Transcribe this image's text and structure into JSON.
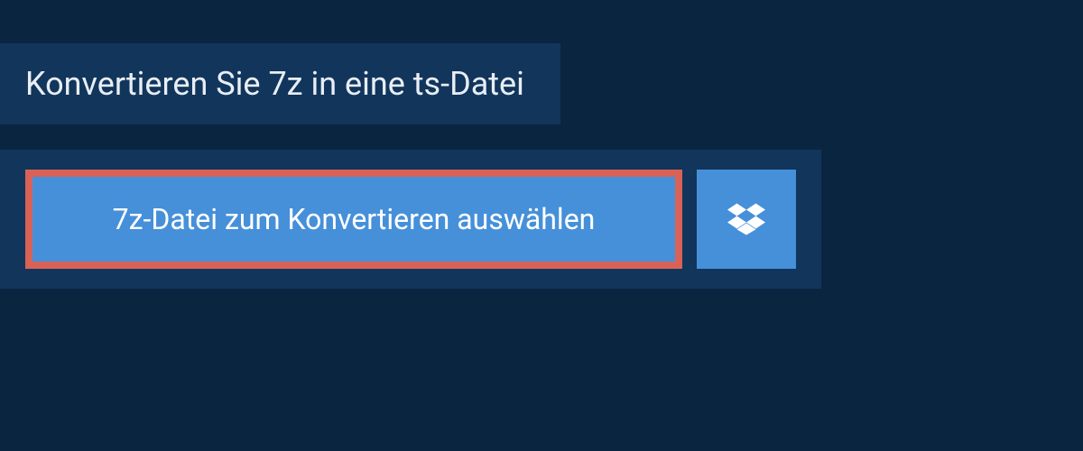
{
  "header": {
    "title": "Konvertieren Sie 7z in eine ts-Datei"
  },
  "upload": {
    "select_file_label": "7z-Datei zum Konvertieren auswählen",
    "dropbox_icon_name": "dropbox-icon"
  },
  "colors": {
    "background": "#0a2540",
    "panel": "#12355b",
    "button": "#4690d9",
    "highlight_border": "#d96257",
    "text_light": "#e8eef5"
  }
}
